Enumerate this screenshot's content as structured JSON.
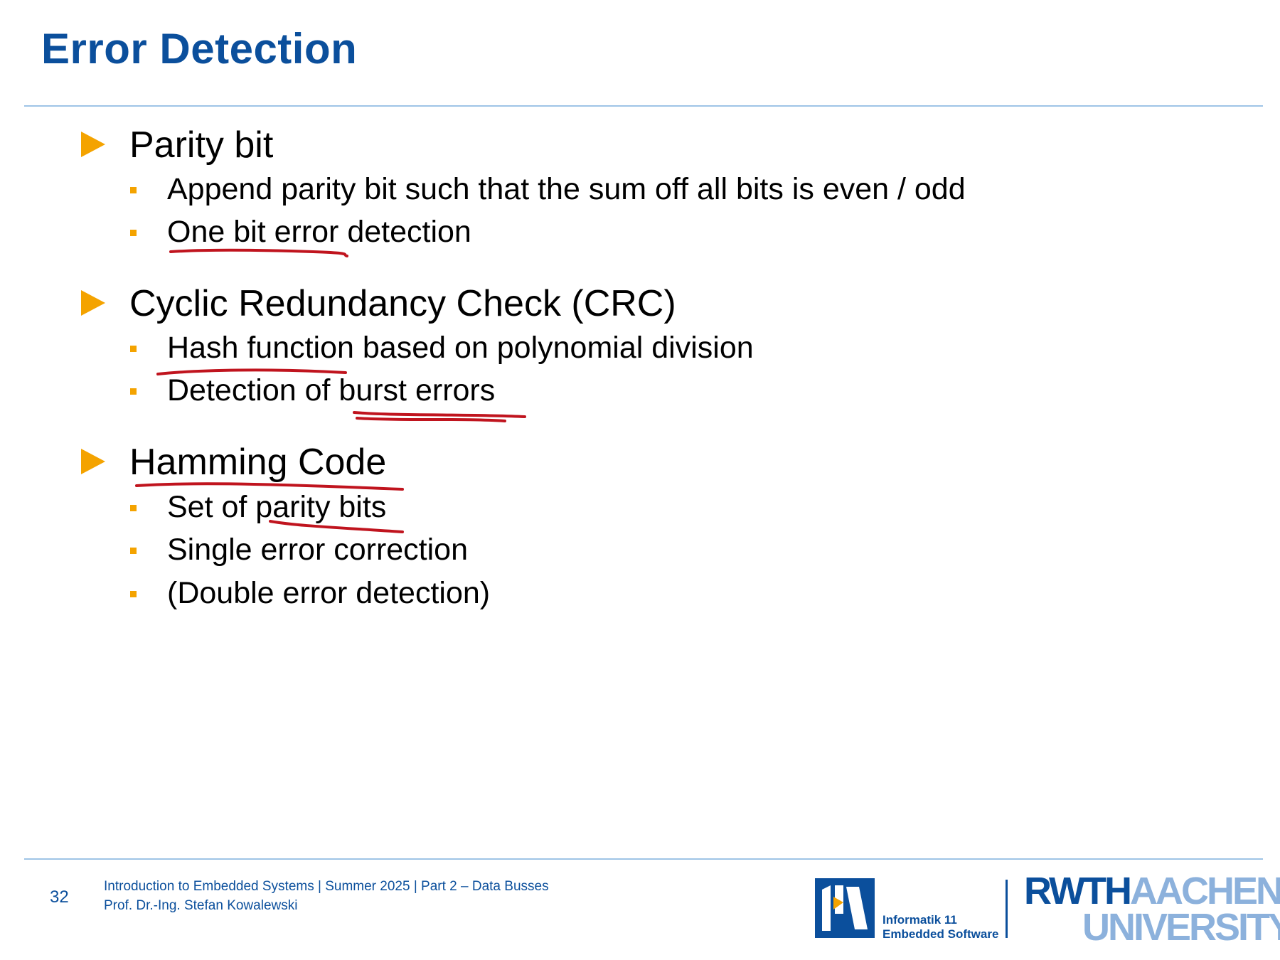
{
  "slide": {
    "title": "Error Detection",
    "sections": [
      {
        "heading": "Parity bit",
        "items": [
          "Append parity bit such that the sum off all bits is even / odd",
          "One bit error detection"
        ]
      },
      {
        "heading": "Cyclic Redundancy Check (CRC)",
        "items": [
          "Hash function based on polynomial division",
          "Detection of burst errors"
        ]
      },
      {
        "heading": "Hamming Code",
        "items": [
          "Set of parity bits",
          "Single error correction",
          "(Double error detection)"
        ]
      }
    ]
  },
  "footer": {
    "slide_number": "32",
    "course_line": "Introduction to Embedded Systems | Summer 2025 | Part 2 – Data Busses",
    "author_line": "Prof. Dr.-Ing. Stefan Kowalewski"
  },
  "logos": {
    "institute_line1": "Informatik 11",
    "institute_line2": "Embedded Software",
    "university_word1": "RWTH",
    "university_word2": "AACHEN",
    "university_word3": "UNIVERSITY"
  },
  "colors": {
    "title_blue": "#0b4f9c",
    "bullet_orange": "#f4a300",
    "rule_light_blue": "#9ec4e6",
    "annotation_red": "#c0141e"
  }
}
